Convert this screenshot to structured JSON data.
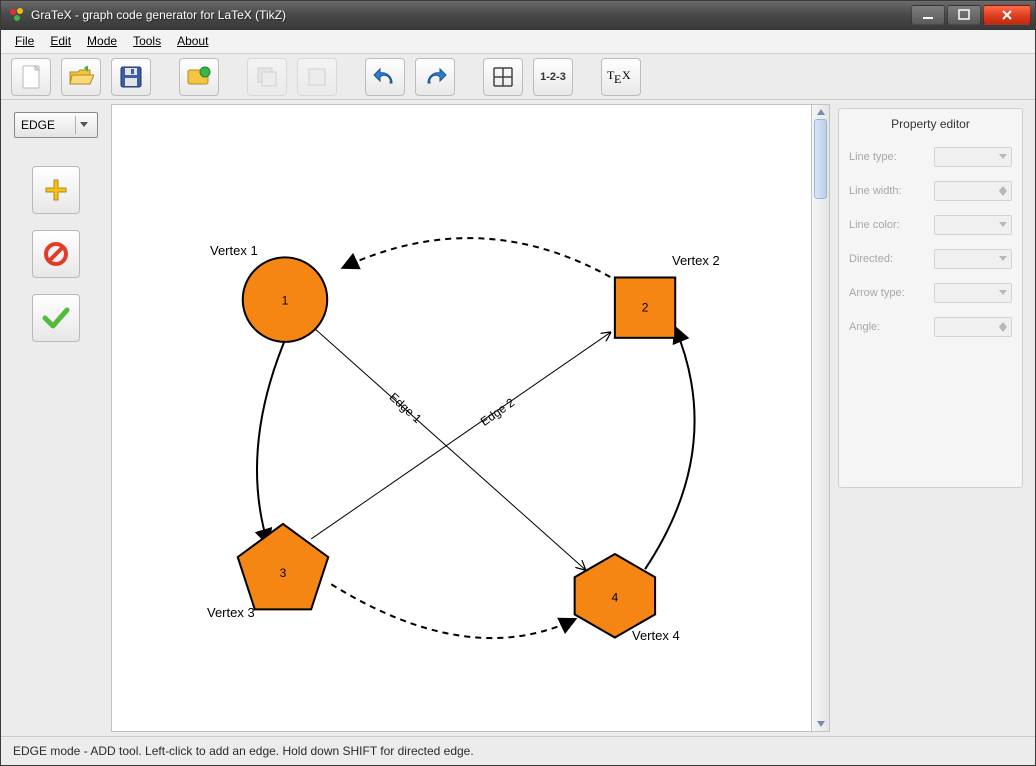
{
  "window": {
    "title": "GraTeX - graph code generator for LaTeX (TikZ)"
  },
  "menubar": {
    "file": "File",
    "edit": "Edit",
    "mode": "Mode",
    "tools": "Tools",
    "about": "About"
  },
  "toolbar": {
    "new": "New",
    "open": "Open",
    "save": "Save",
    "template": "Template",
    "copy": "Copy",
    "duplicate": "Duplicate",
    "undo": "Undo",
    "redo": "Redo",
    "grid": "Grid",
    "numbering": "1-2-3",
    "tex": "TeX"
  },
  "palette": {
    "mode": "EDGE",
    "add": "Add",
    "delete": "Delete",
    "accept": "Accept"
  },
  "properties": {
    "title": "Property editor",
    "line_type": "Line type:",
    "line_width": "Line width:",
    "line_color": "Line color:",
    "directed": "Directed:",
    "arrow_type": "Arrow type:",
    "angle": "Angle:"
  },
  "canvas": {
    "vertices": [
      {
        "id": "1",
        "label": "Vertex 1"
      },
      {
        "id": "2",
        "label": "Vertex 2"
      },
      {
        "id": "3",
        "label": "Vertex 3"
      },
      {
        "id": "4",
        "label": "Vertex 4"
      }
    ],
    "edges": [
      {
        "label": "Edge 1"
      },
      {
        "label": "Edge 2"
      }
    ],
    "fill_color": "#f58613"
  },
  "statusbar": {
    "text": "EDGE mode - ADD tool. Left-click to add an edge. Hold down SHIFT for directed edge."
  }
}
